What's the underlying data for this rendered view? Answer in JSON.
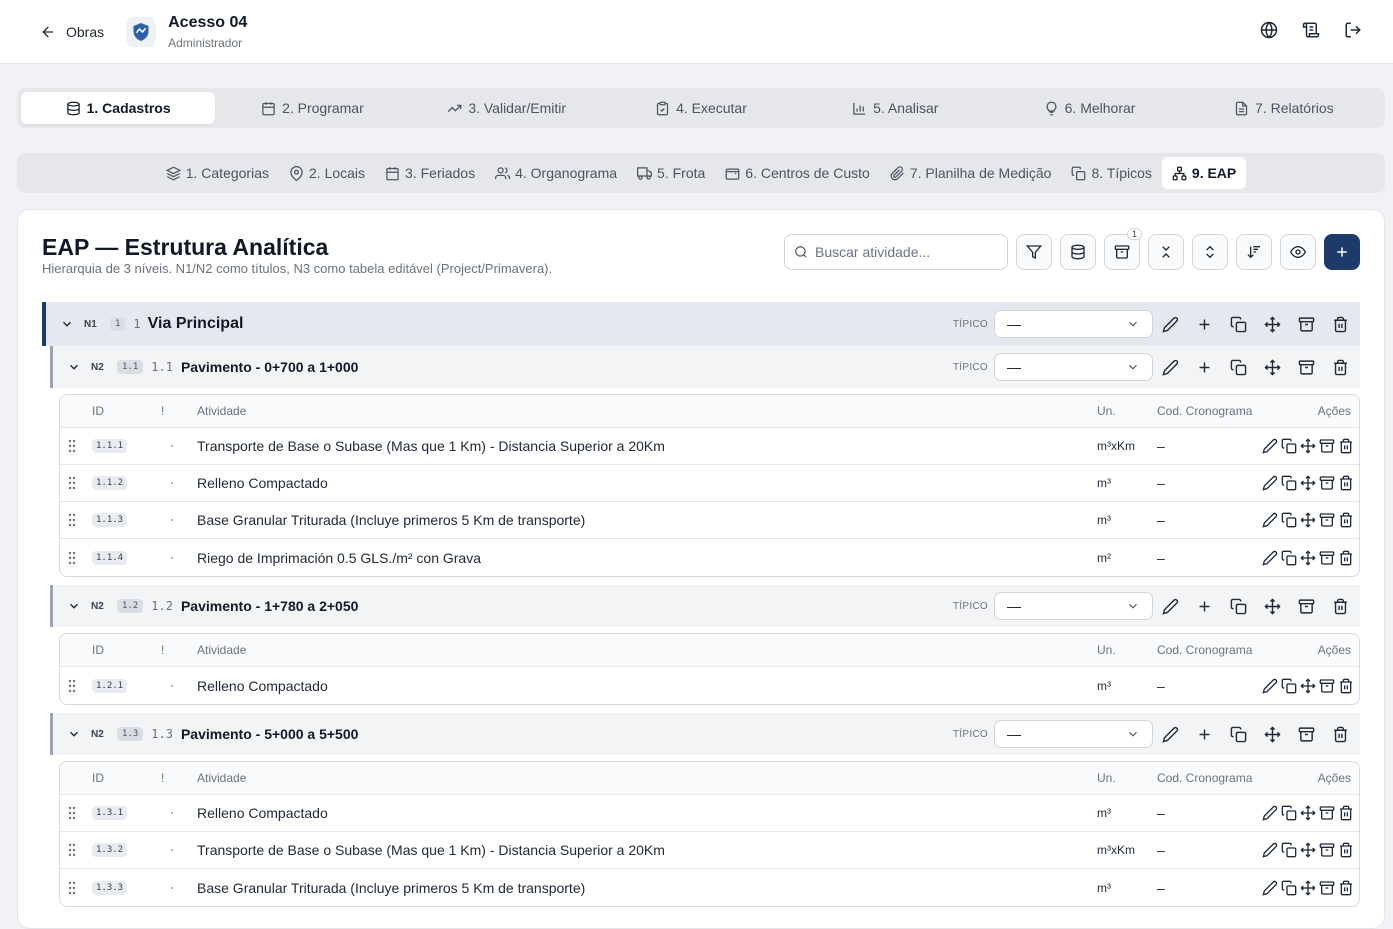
{
  "header": {
    "back_label": "Obras",
    "project_title": "Acesso 04",
    "role": "Administrador"
  },
  "main_tabs": [
    {
      "label": "1. Cadastros",
      "icon": "database-icon",
      "active": true
    },
    {
      "label": "2. Programar",
      "icon": "calendar-icon"
    },
    {
      "label": "3. Validar/Emitir",
      "icon": "trending-up-icon"
    },
    {
      "label": "4. Executar",
      "icon": "clipboard-check-icon"
    },
    {
      "label": "5. Analisar",
      "icon": "bar-chart-icon"
    },
    {
      "label": "6. Melhorar",
      "icon": "lightbulb-icon"
    },
    {
      "label": "7. Relatórios",
      "icon": "file-text-icon"
    }
  ],
  "sub_tabs": [
    {
      "label": "1. Categorias",
      "icon": "layers-icon"
    },
    {
      "label": "2. Locais",
      "icon": "map-pin-icon"
    },
    {
      "label": "3. Feriados",
      "icon": "calendar-days-icon"
    },
    {
      "label": "4. Organograma",
      "icon": "users-icon"
    },
    {
      "label": "5. Frota",
      "icon": "truck-icon"
    },
    {
      "label": "6. Centros de Custo",
      "icon": "wallet-icon"
    },
    {
      "label": "7. Planilha de Medição",
      "icon": "paperclip-icon"
    },
    {
      "label": "8. Típicos",
      "icon": "copy-icon"
    },
    {
      "label": "9. EAP",
      "icon": "network-icon",
      "active": true
    }
  ],
  "page": {
    "title": "EAP — Estrutura Analítica",
    "subtitle": "Hierarquia de 3 níveis. N1/N2 como títulos, N3 como tabela editável (Project/Primavera).",
    "search_placeholder": "Buscar atividade...",
    "archive_badge": "1"
  },
  "labels": {
    "tipico": "TÍPICO",
    "select_value": "—",
    "col_id": "ID",
    "col_flag": "!",
    "col_atividade": "Atividade",
    "col_un": "Un.",
    "col_cod": "Cod. Cronograma",
    "col_acoes": "Ações"
  },
  "n1": {
    "level": "N1",
    "badge": "1",
    "code": "1",
    "name": "Via Principal"
  },
  "groups": [
    {
      "level": "N2",
      "badge": "1.1",
      "code": "1.1",
      "name": "Pavimento - 0+700 a 1+000",
      "rows": [
        {
          "id": "1.1.1",
          "atividade": "Transporte de Base o Subase (Mas que 1 Km) - Distancia Superior a 20Km",
          "un": "m³xKm",
          "cod": "–"
        },
        {
          "id": "1.1.2",
          "atividade": "Relleno Compactado",
          "un": "m³",
          "cod": "–"
        },
        {
          "id": "1.1.3",
          "atividade": "Base Granular Triturada (Incluye primeros 5 Km de transporte)",
          "un": "m³",
          "cod": "–"
        },
        {
          "id": "1.1.4",
          "atividade": "Riego de Imprimación 0.5 GLS./m² con Grava",
          "un": "m²",
          "cod": "–"
        }
      ]
    },
    {
      "level": "N2",
      "badge": "1.2",
      "code": "1.2",
      "name": "Pavimento - 1+780 a 2+050",
      "rows": [
        {
          "id": "1.2.1",
          "atividade": "Relleno Compactado",
          "un": "m³",
          "cod": "–"
        }
      ]
    },
    {
      "level": "N2",
      "badge": "1.3",
      "code": "1.3",
      "name": "Pavimento - 5+000 a 5+500",
      "rows": [
        {
          "id": "1.3.1",
          "atividade": "Relleno Compactado",
          "un": "m³",
          "cod": "–"
        },
        {
          "id": "1.3.2",
          "atividade": "Transporte de Base o Subase (Mas que 1 Km) - Distancia Superior a 20Km",
          "un": "m³xKm",
          "cod": "–"
        },
        {
          "id": "1.3.3",
          "atividade": "Base Granular Triturada (Incluye primeros 5 Km de transporte)",
          "un": "m³",
          "cod": "–"
        }
      ]
    }
  ],
  "colors": {
    "primary": "#1e3a6b",
    "n2_border": "#9aa4b4"
  }
}
